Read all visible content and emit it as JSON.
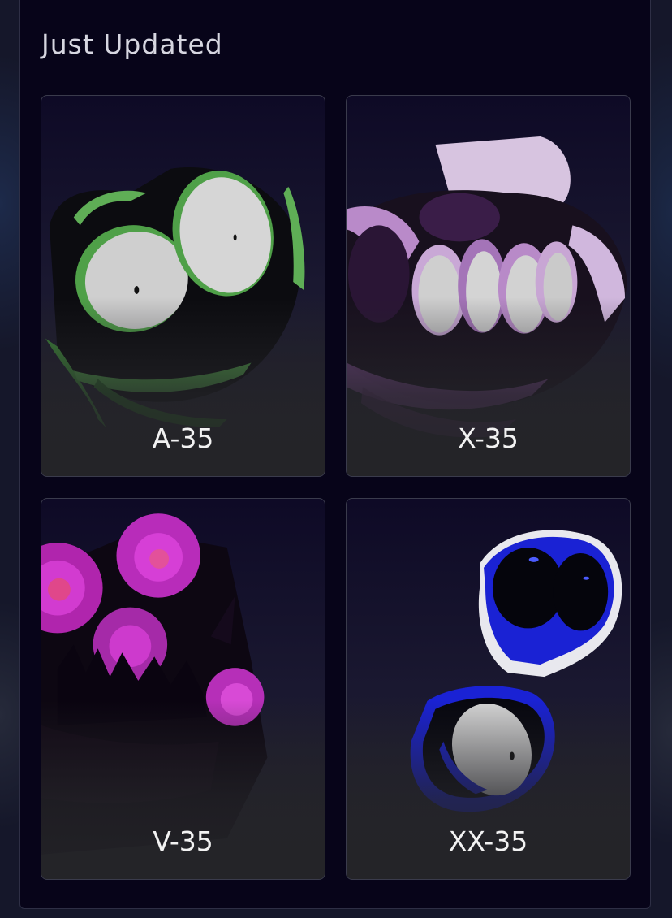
{
  "section": {
    "title": "Just Updated"
  },
  "cards": [
    {
      "label": "A-35",
      "art": "green-eyed-creature-image",
      "accent": "#4c9a44"
    },
    {
      "label": "X-35",
      "art": "purple-multi-eyed-creature-image",
      "accent": "#b78ac8"
    },
    {
      "label": "V-35",
      "art": "magenta-toothed-creature-image",
      "accent": "#d235d4"
    },
    {
      "label": "XX-35",
      "art": "blue-eyed-creatures-image",
      "accent": "#1b22d6"
    }
  ],
  "colors": {
    "panel_background": "#070419",
    "panel_border": "#2e2f45",
    "title_text": "#d6d6e0",
    "label_text": "#f2f2f2"
  }
}
